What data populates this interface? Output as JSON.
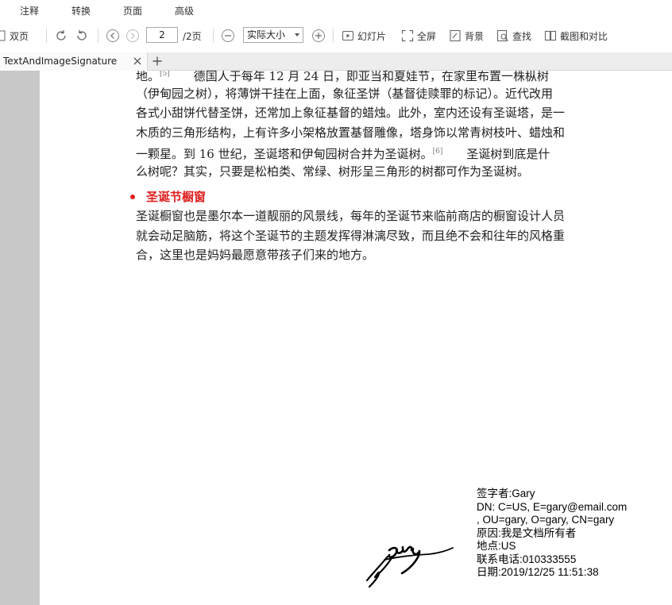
{
  "menu": [
    "注释",
    "转换",
    "页面",
    "高级"
  ],
  "toolbar": {
    "double_page": "双页",
    "page_number": "2",
    "page_total": "/2页",
    "zoom": "实际大小",
    "slideshow": "幻灯片",
    "fullscreen": "全屏",
    "background": "背景",
    "find": "查找",
    "snapshot_compare": "截图和对比"
  },
  "tab": {
    "title": "TextAndImageSignature"
  },
  "document": {
    "para1": [
      {
        "text": "地。",
        "sup": "[5]",
        "after": "　　德国人于每年 12 月 24 日，即亚当和夏娃节，在家里布置一株枞树"
      },
      {
        "text": "（伊甸园之树），将薄饼干挂在上面，象征圣饼（基督徒赎罪的标记）。近代改用"
      },
      {
        "text": "各式小甜饼代替圣饼，还常加上象征基督的蜡烛。此外，室内还设有圣诞塔，是一"
      },
      {
        "text": "木质的三角形结构，上有许多小架格放置基督雕像，塔身饰以常青树枝叶、蜡烛和"
      },
      {
        "text": "一颗星。到 16 世纪，圣诞塔和伊甸园树合并为圣诞树。",
        "sup": "[6]",
        "after": "　　圣诞树到底是什"
      },
      {
        "text": "么树呢？其实，只要是松柏类、常绿、树形呈三角形的树都可作为圣诞树。"
      }
    ],
    "heading": "圣诞节橱窗",
    "para2": [
      "圣诞橱窗也是墨尔本一道靓丽的风景线，每年的圣诞节来临前商店的橱窗设计人员",
      "就会动足脑筋，将这个圣诞节的主题发挥得淋漓尽致，而且绝不会和往年的风格重",
      "合，这里也是妈妈最愿意带孩子们来的地方。"
    ]
  },
  "signature": {
    "image_text": "gary",
    "lines": [
      "签字者:Gary",
      "DN: C=US, E=gary@email.com",
      ", OU=gary, O=gary, CN=gary",
      "原因:我是文档所有者",
      "地点:US",
      "联系电话:010333555",
      "日期:2019/12/25 11:51:38"
    ]
  },
  "colors": {
    "heading": "#e02020",
    "gutter": "#c8c8c8"
  }
}
